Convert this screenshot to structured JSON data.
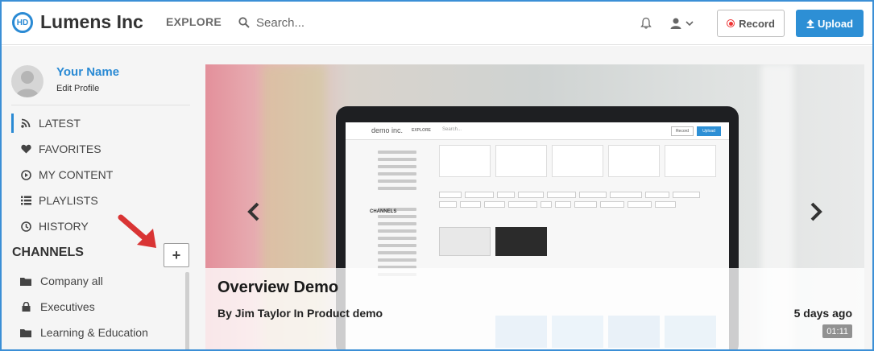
{
  "header": {
    "logo_text": "HD",
    "brand": "Lumens Inc",
    "explore": "EXPLORE",
    "search_placeholder": "Search...",
    "record_label": "Record",
    "upload_label": "Upload"
  },
  "profile": {
    "name": "Your Name",
    "edit": "Edit Profile"
  },
  "nav": {
    "items": [
      {
        "label": "LATEST",
        "icon": "rss-icon",
        "active": true
      },
      {
        "label": "FAVORITES",
        "icon": "heart-icon",
        "active": false
      },
      {
        "label": "MY CONTENT",
        "icon": "play-circle-icon",
        "active": false
      },
      {
        "label": "PLAYLISTS",
        "icon": "list-icon",
        "active": false
      },
      {
        "label": "HISTORY",
        "icon": "clock-icon",
        "active": false
      }
    ]
  },
  "channels": {
    "heading": "CHANNELS",
    "add_label": "+",
    "items": [
      {
        "label": "Company all",
        "icon": "folder-icon"
      },
      {
        "label": "Executives",
        "icon": "lock-icon"
      },
      {
        "label": "Learning & Education",
        "icon": "folder-icon"
      }
    ]
  },
  "featured": {
    "title": "Overview Demo",
    "meta": "By Jim Taylor In Product demo",
    "age": "5 days ago",
    "duration": "01:11"
  },
  "preview": {
    "brand": "demo inc.",
    "explore": "EXPLORE",
    "search": "Search...",
    "record": "Record",
    "upload": "Upload",
    "channels": "CHANNELS"
  },
  "colors": {
    "accent": "#2a8ad4",
    "upload_bg": "#2d8fd5",
    "record_dot": "#e33333",
    "annotation_arrow": "#d93434"
  }
}
